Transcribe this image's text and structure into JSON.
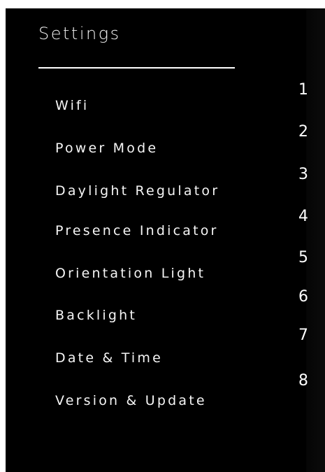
{
  "settings": {
    "title": "Settings",
    "items": [
      {
        "label": "Wifi"
      },
      {
        "label": "Power Mode"
      },
      {
        "label": "Daylight Regulator"
      },
      {
        "label": "Presence Indicator"
      },
      {
        "label": "Orientation Light"
      },
      {
        "label": "Backlight"
      },
      {
        "label": "Date & Time"
      },
      {
        "label": "Version & Update"
      }
    ],
    "indices": [
      "1",
      "2",
      "3",
      "4",
      "5",
      "6",
      "7",
      "8"
    ]
  }
}
